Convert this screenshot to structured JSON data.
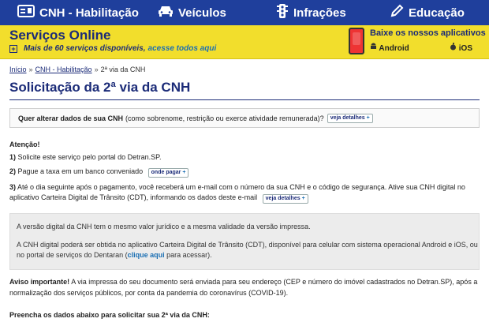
{
  "nav": {
    "cnh": "CNH - Habilitação",
    "veiculos": "Veículos",
    "infracoes": "Infrações",
    "educacao": "Educação"
  },
  "banner": {
    "title": "Serviços Online",
    "services_count": "Mais de 60 serviços disponíveis,",
    "access_all": "acesse todos aqui",
    "apps_title": "Baixe os nossos aplicativos",
    "android": "Android",
    "ios": "iOS"
  },
  "breadcrumb": {
    "home": "Início",
    "section": "CNH - Habilitação",
    "current": "2ª via da CNH",
    "sep": "»"
  },
  "page": {
    "title": "Solicitação da 2ª via da CNH",
    "question_bold": "Quer alterar dados de sua CNH",
    "question_rest": "(como sobrenome, restrição ou exerce atividade remunerada)?",
    "details_link": "veja detalhes",
    "attention": "Atenção!",
    "step1_num": "1)",
    "step1": "Solicite este serviço pelo portal do Detran.SP.",
    "step2_num": "2)",
    "step2": "Pague a taxa em um banco conveniado",
    "where_pay": "onde pagar",
    "step3_num": "3)",
    "step3_line1": "Até o dia seguinte após o pagamento, você receberá um e-mail com o número da sua CNH e o código de segurança. Ative sua CNH digital no",
    "step3_line2": "aplicativo Carteira Digital de Trânsito (CDT), informando os dados deste e-mail",
    "info_line1": "A versão digital da CNH tem o mesmo valor jurídico e a mesma validade da versão impressa.",
    "info_line2": "A CNH digital poderá ser obtida no aplicativo Carteira Digital de Trânsito (CDT), disponível para celular com sistema operacional Android e iOS, ou",
    "info_line3a": "no portal de serviços do Dentaran (",
    "info_click": "clique aqui",
    "info_line3b": " para acessar).",
    "warning_bold": "Aviso importante!",
    "warning_line1": " A via impressa do seu documento será enviada para seu endereço (CEP e número do imóvel cadastrados no Detran.SP), após a",
    "warning_line2": "normalização dos serviços públicos, por conta da pandemia do coronavírus (COVID-19).",
    "fill_form": "Preencha os dados abaixo para solicitar sua 2ª via da CNH:"
  },
  "icons": {
    "cnh": "id-card-icon",
    "veiculos": "car-icon",
    "infracoes": "traffic-light-icon",
    "educacao": "pencil-icon"
  },
  "colors": {
    "nav_bg": "#1f3f9c",
    "banner_bg": "#f2de2c",
    "title_color": "#1b2b78",
    "link_color": "#1b6fb3"
  }
}
